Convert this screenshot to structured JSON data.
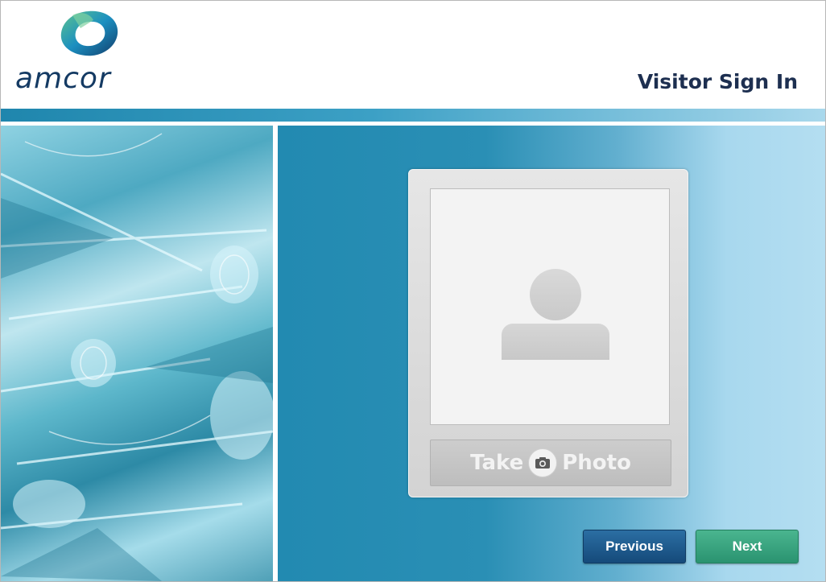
{
  "header": {
    "brand": "amcor",
    "title": "Visitor Sign In"
  },
  "photo_panel": {
    "take_label_left": "Take",
    "take_label_right": "Photo"
  },
  "nav": {
    "previous_label": "Previous",
    "next_label": "Next"
  },
  "icons": {
    "logo": "amcor-logo-icon",
    "avatar": "avatar-placeholder-icon",
    "camera": "camera-icon"
  },
  "colors": {
    "brand_navy": "#143a63",
    "panel_blue": "#228ab1",
    "previous_button": "#1f5d90",
    "next_button": "#38a47f"
  }
}
